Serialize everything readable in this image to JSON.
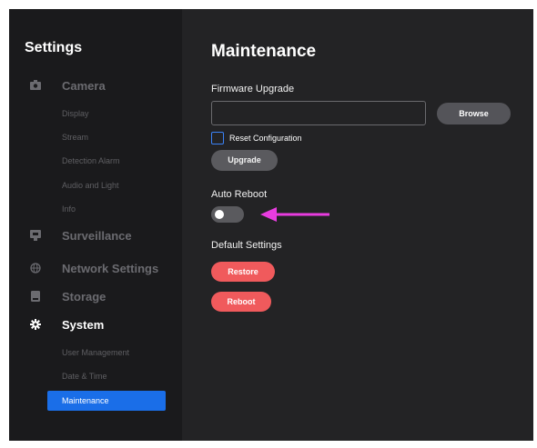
{
  "sidebar": {
    "title": "Settings",
    "camera": {
      "label": "Camera",
      "icon": "camera-icon",
      "items": [
        "Display",
        "Stream",
        "Detection Alarm",
        "Audio and Light",
        "Info"
      ]
    },
    "surveillance": {
      "label": "Surveillance",
      "icon": "surveillance-icon"
    },
    "network": {
      "label": "Network Settings",
      "icon": "globe-icon"
    },
    "storage": {
      "label": "Storage",
      "icon": "storage-icon"
    },
    "system": {
      "label": "System",
      "icon": "gear-icon",
      "items": [
        "User Management",
        "Date & Time",
        "Maintenance"
      ],
      "active": "Maintenance"
    }
  },
  "main": {
    "title": "Maintenance",
    "firmware": {
      "label": "Firmware Upgrade",
      "input_value": "",
      "browse_label": "Browse",
      "reset_config_label": "Reset Configuration",
      "reset_config_checked": false,
      "upgrade_label": "Upgrade"
    },
    "auto_reboot": {
      "label": "Auto Reboot",
      "enabled": false
    },
    "default_settings": {
      "label": "Default Settings",
      "restore_label": "Restore",
      "reboot_label": "Reboot"
    }
  },
  "colors": {
    "accent": "#1a6ee8",
    "danger": "#f05a5c",
    "annotation_arrow": "#e93ce0"
  }
}
